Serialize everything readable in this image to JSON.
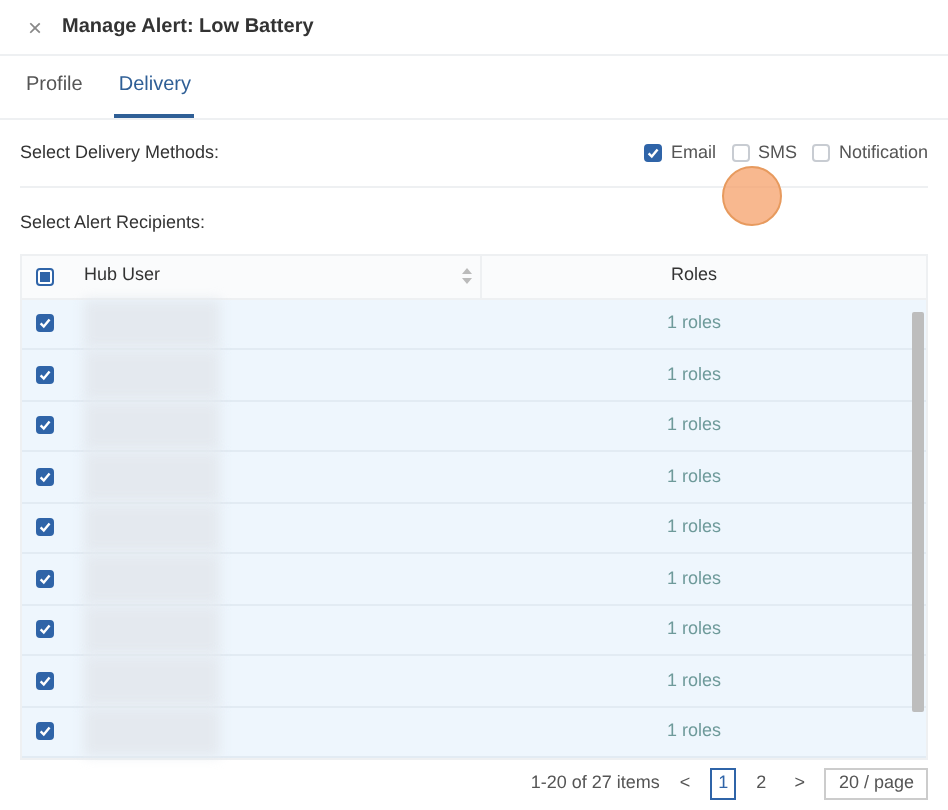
{
  "window": {
    "title": "Manage Alert: Low Battery",
    "close_icon": "×"
  },
  "tabs": [
    {
      "label": "Profile",
      "selected": false
    },
    {
      "label": "Delivery",
      "selected": true
    }
  ],
  "delivery": {
    "label": "Select Delivery Methods:",
    "methods": [
      {
        "label": "Email",
        "checked": true
      },
      {
        "label": "SMS",
        "checked": false
      },
      {
        "label": "Notification",
        "checked": false
      }
    ]
  },
  "recipients": {
    "label": "Select Alert Recipients:",
    "columns": [
      "Hub User",
      "Roles"
    ],
    "select_all_indeterminate": true,
    "rows": [
      {
        "checked": true,
        "roles": "1 roles"
      },
      {
        "checked": true,
        "roles": "1 roles"
      },
      {
        "checked": true,
        "roles": "1 roles"
      },
      {
        "checked": true,
        "roles": "1 roles"
      },
      {
        "checked": true,
        "roles": "1 roles"
      },
      {
        "checked": true,
        "roles": "1 roles"
      },
      {
        "checked": true,
        "roles": "1 roles"
      },
      {
        "checked": true,
        "roles": "1 roles"
      },
      {
        "checked": true,
        "roles": "1 roles"
      }
    ]
  },
  "pagination": {
    "summary": "1-20 of 27 items",
    "prev": "<",
    "pages": [
      {
        "label": "1",
        "selected": true
      },
      {
        "label": "2",
        "selected": false
      }
    ],
    "next": ">",
    "page_size": "20 / page"
  }
}
